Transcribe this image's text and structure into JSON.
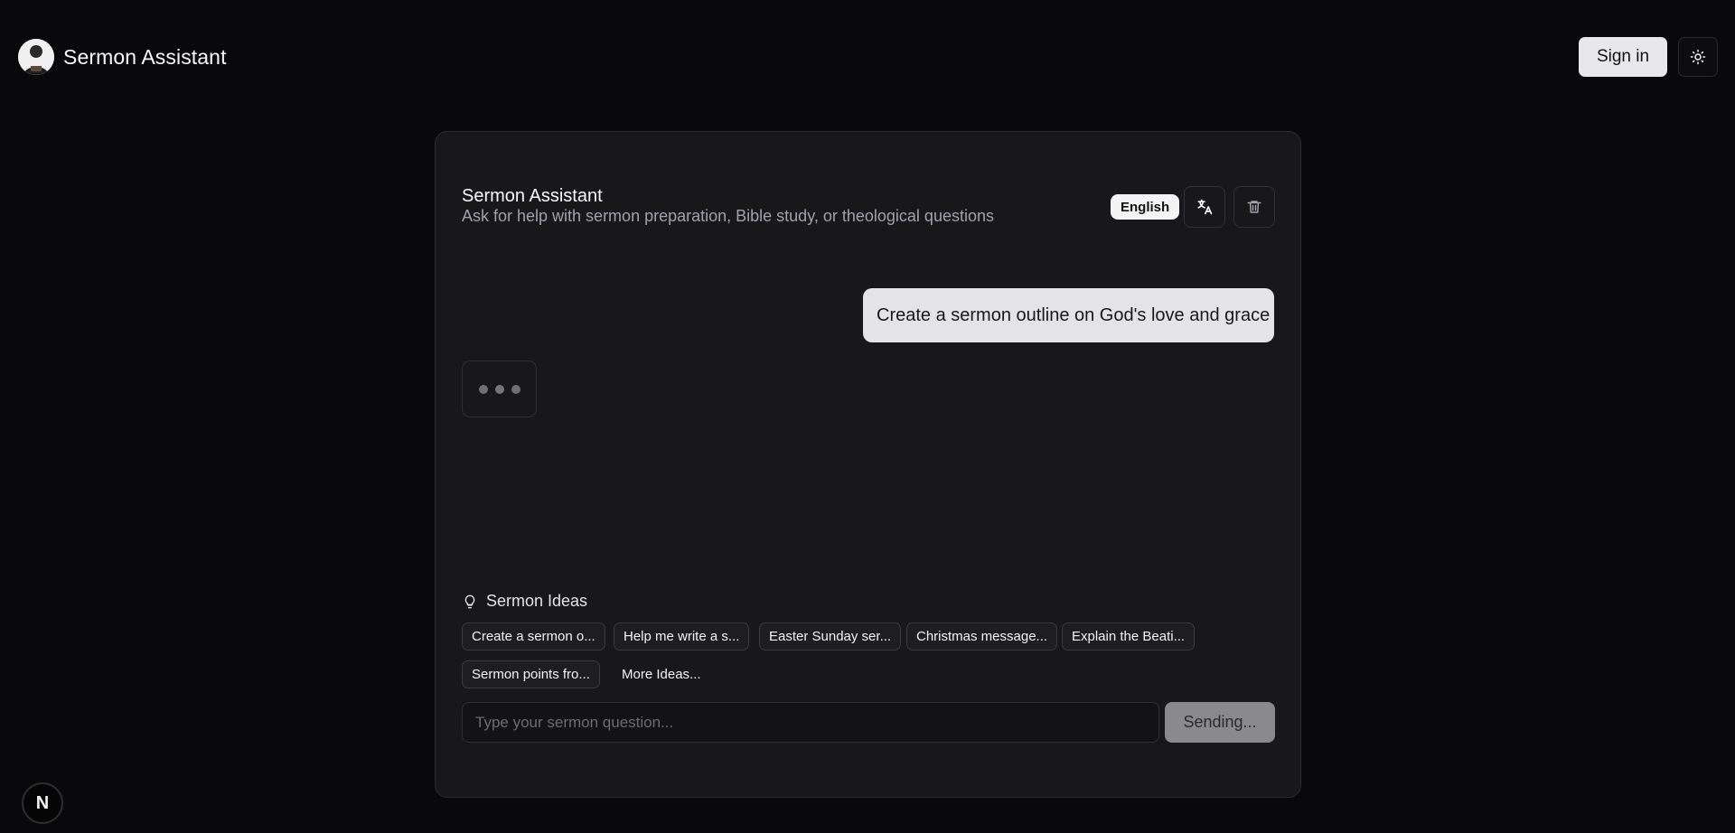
{
  "header": {
    "title": "Sermon Assistant",
    "sign_in_label": "Sign in",
    "theme_icon": "sun-icon"
  },
  "card": {
    "title": "Sermon Assistant",
    "subtitle": "Ask for help with sermon preparation, Bible study, or theological questions",
    "language_badge": "English",
    "translate_icon": "translate-icon",
    "delete_icon": "trash-icon"
  },
  "messages": [
    {
      "role": "user",
      "text": "Create a sermon outline on God's love and grace"
    }
  ],
  "ideas": {
    "title": "Sermon Ideas",
    "chips": [
      "Create a sermon o...",
      "Help me write a s...",
      "Easter Sunday ser...",
      "Christmas message...",
      "Explain the Beati...",
      "Sermon points fro..."
    ],
    "more_label": "More Ideas..."
  },
  "composer": {
    "placeholder": "Type your sermon question...",
    "value": "",
    "send_label": "Sending..."
  },
  "dev_badge": {
    "label": "N"
  },
  "colors": {
    "background": "#09090b",
    "card": "#18181b",
    "user_bubble": "#e4e4e7",
    "send_disabled": "#8a8a8e"
  }
}
